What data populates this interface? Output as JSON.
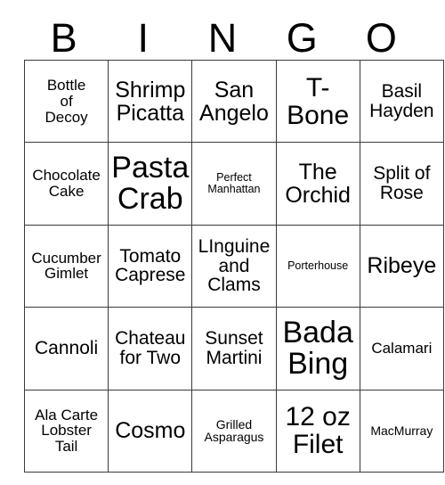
{
  "card": {
    "title": "BINGO Card",
    "header_letters": [
      "B",
      "I",
      "N",
      "G",
      "O"
    ],
    "rows": [
      [
        {
          "text": "Bottle\nof\nDecoy",
          "size": "sm"
        },
        {
          "text": "Shrimp\nPicatta",
          "size": "lg"
        },
        {
          "text": "San\nAngelo",
          "size": "lg"
        },
        {
          "text": "T-\nBone",
          "size": "xl"
        },
        {
          "text": "Basil\nHayden",
          "size": "md"
        }
      ],
      [
        {
          "text": "Chocolate\nCake",
          "size": "sm"
        },
        {
          "text": "Pasta\nCrab",
          "size": "xxl"
        },
        {
          "text": "Perfect\nManhattan",
          "size": "xxs"
        },
        {
          "text": "The\nOrchid",
          "size": "lg"
        },
        {
          "text": "Split of\nRose",
          "size": "md"
        }
      ],
      [
        {
          "text": "Cucumber\nGimlet",
          "size": "sm"
        },
        {
          "text": "Tomato\nCaprese",
          "size": "md"
        },
        {
          "text": "LInguine\nand\nClams",
          "size": "md"
        },
        {
          "text": "Porterhouse",
          "size": "xxs"
        },
        {
          "text": "Ribeye",
          "size": "lg"
        }
      ],
      [
        {
          "text": "Cannoli",
          "size": "md"
        },
        {
          "text": "Chateau\nfor Two",
          "size": "md"
        },
        {
          "text": "Sunset\nMartini",
          "size": "md"
        },
        {
          "text": "Bada\nBing",
          "size": "xxl"
        },
        {
          "text": "Calamari",
          "size": "sm"
        }
      ],
      [
        {
          "text": "Ala Carte\nLobster\nTail",
          "size": "sm"
        },
        {
          "text": "Cosmo",
          "size": "lg"
        },
        {
          "text": "Grilled\nAsparagus",
          "size": "xs"
        },
        {
          "text": "12 oz\nFilet",
          "size": "xl"
        },
        {
          "text": "MacMurray",
          "size": "xs"
        }
      ]
    ]
  }
}
